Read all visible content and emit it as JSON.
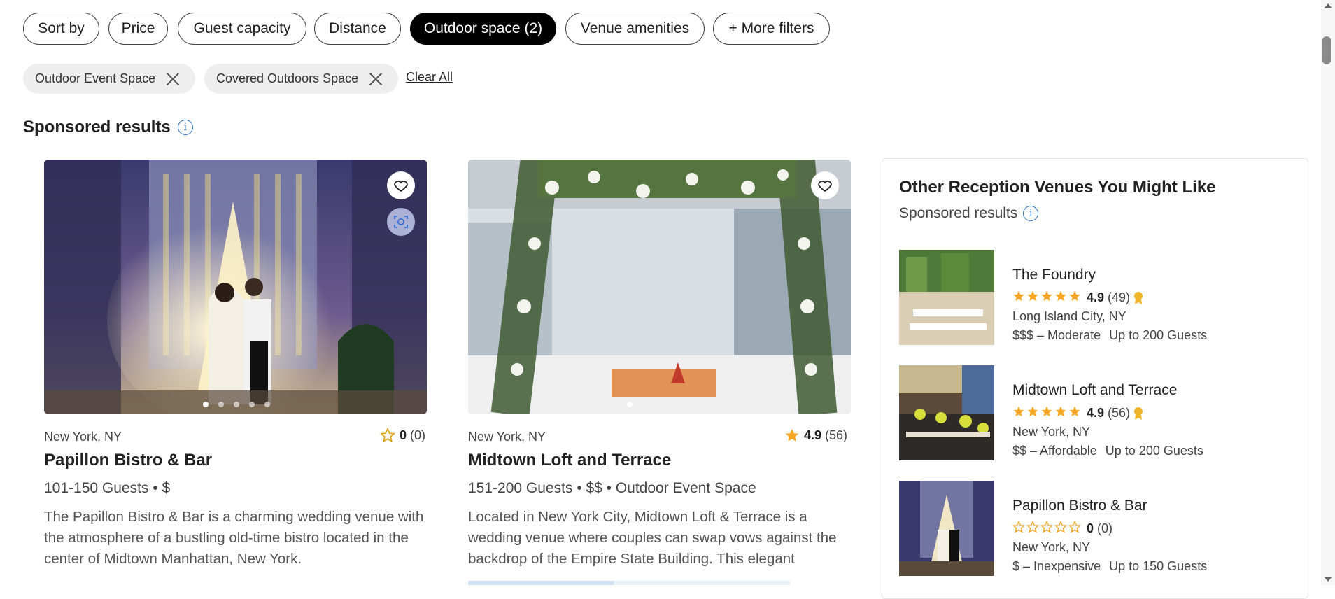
{
  "filters": {
    "pills": [
      "Sort by",
      "Price",
      "Guest capacity",
      "Distance",
      "Outdoor space (2)",
      "Venue amenities",
      "+ More filters"
    ],
    "active_index": 4,
    "chips": [
      "Outdoor Event Space",
      "Covered Outdoors Space"
    ],
    "clear_all": "Clear All"
  },
  "sponsored": {
    "heading": "Sponsored results",
    "info_glyph": "i"
  },
  "cards": [
    {
      "location": "New York, NY",
      "rating": "0",
      "reviews": "(0)",
      "name": "Papillon Bistro & Bar",
      "meta": "101-150 Guests • $",
      "description": "The Papillon Bistro & Bar is a charming wedding venue with the atmosphere of a bustling old-time bistro located in the center of Midtown Manhattan, New York."
    },
    {
      "location": "New York, NY",
      "rating": "4.9",
      "reviews": "(56)",
      "name": "Midtown Loft and Terrace",
      "meta": "151-200 Guests • $$ • Outdoor Event Space",
      "description": "Located in New York City, Midtown Loft & Terrace is a wedding venue where couples can swap vows against the backdrop of the Empire State Building. This elegant"
    }
  ],
  "sidebar": {
    "title": "Other Reception Venues You Might Like",
    "subtitle": "Sponsored results",
    "items": [
      {
        "name": "The Foundry",
        "rating": "4.9",
        "reviews": "(49)",
        "stars": 5,
        "location": "Long Island City, NY",
        "price": "$$$ – Moderate",
        "guests": "Up to 200 Guests"
      },
      {
        "name": "Midtown Loft and Terrace",
        "rating": "4.9",
        "reviews": "(56)",
        "stars": 5,
        "location": "New York, NY",
        "price": "$$ – Affordable",
        "guests": "Up to 200 Guests"
      },
      {
        "name": "Papillon Bistro & Bar",
        "rating": "0",
        "reviews": "(0)",
        "stars": 0,
        "location": "New York, NY",
        "price": "$ – Inexpensive",
        "guests": "Up to 150 Guests"
      }
    ]
  },
  "colors": {
    "star": "#f5a623",
    "badge": "#f0b429",
    "info": "#2a72c4",
    "active_pill": "#000000"
  },
  "icons": [
    "heart-icon",
    "visual-search-icon",
    "close-icon",
    "info-icon",
    "star-icon",
    "award-badge-icon"
  ]
}
